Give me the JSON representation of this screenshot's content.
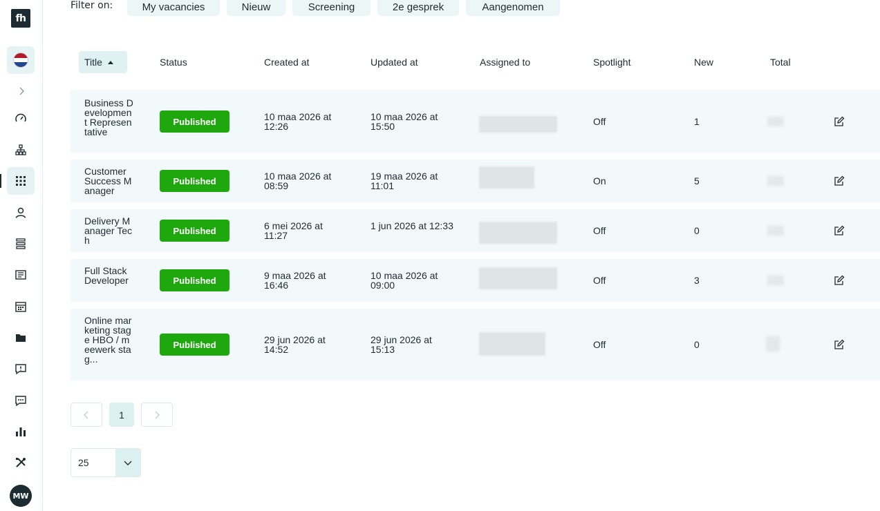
{
  "sidebar": {
    "logo": "fh",
    "items": [
      {
        "icon": "gauge-icon",
        "label": "dashboard"
      },
      {
        "icon": "org-chart-icon",
        "label": "organisation"
      },
      {
        "icon": "grid-icon",
        "label": "vacancies",
        "active": true
      },
      {
        "icon": "user-icon",
        "label": "candidates"
      },
      {
        "icon": "list-icon",
        "label": "lists"
      },
      {
        "icon": "newspaper-icon",
        "label": "content"
      },
      {
        "icon": "calendar-icon",
        "label": "calendar"
      },
      {
        "icon": "folder-icon",
        "label": "files"
      },
      {
        "icon": "feedback-icon",
        "label": "feedback"
      },
      {
        "icon": "chat-icon",
        "label": "messages"
      },
      {
        "icon": "bar-chart-icon",
        "label": "reports"
      },
      {
        "icon": "tools-icon",
        "label": "settings"
      }
    ],
    "avatar": "MW"
  },
  "filters": {
    "label": "Filter on:",
    "chips": [
      "My vacancies",
      "Nieuw",
      "Screening",
      "2e gesprek",
      "Aangenomen"
    ]
  },
  "table": {
    "headers": {
      "title": "Title",
      "status": "Status",
      "created": "Created at",
      "updated": "Updated at",
      "assigned": "Assigned to",
      "spotlight": "Spotlight",
      "new": "New",
      "total": "Total"
    },
    "rows": [
      {
        "title": "Business Development Representative",
        "status": "Published",
        "created": "10 maa 2026 at 12:26",
        "updated": "10 maa 2026 at 15:50",
        "spotlight": "Off",
        "new": "1"
      },
      {
        "title": "Customer Success Manager",
        "status": "Published",
        "created": "10 maa 2026 at 08:59",
        "updated": "19 maa 2026 at 11:01",
        "spotlight": "On",
        "new": "5"
      },
      {
        "title": "Delivery Manager Tech",
        "status": "Published",
        "created": "6 mei 2026 at 11:27",
        "updated": "1 jun 2026 at 12:33",
        "spotlight": "Off",
        "new": "0"
      },
      {
        "title": "Full Stack Developer",
        "status": "Published",
        "created": "9 maa 2026 at 16:46",
        "updated": "10 maa 2026 at 09:00",
        "spotlight": "Off",
        "new": "3"
      },
      {
        "title": "Online marketing stage HBO / meewerk stag...",
        "status": "Published",
        "created": "29 jun 2026 at 14:52",
        "updated": "29 jun 2026 at 15:13",
        "spotlight": "Off",
        "new": "0"
      }
    ]
  },
  "pagination": {
    "current": "1"
  },
  "per_page": {
    "value": "25"
  },
  "colors": {
    "published": "#1fa80e",
    "accent": "#dcf0f2"
  }
}
